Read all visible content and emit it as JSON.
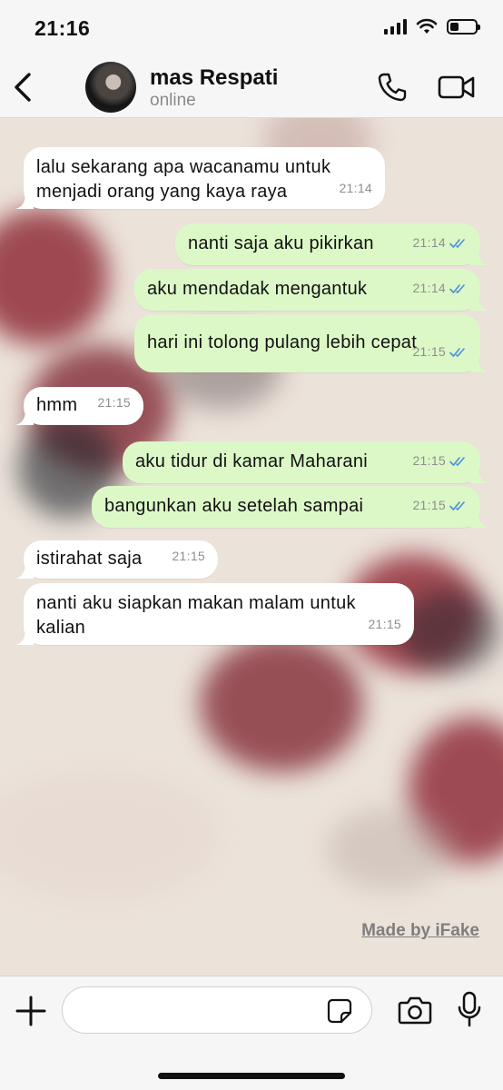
{
  "status_bar": {
    "time": "21:16",
    "battery_level": 0.35
  },
  "header": {
    "contact_name": "mas Respati",
    "contact_status": "online",
    "icons": {
      "back": "chevron-left-icon",
      "call": "phone-icon",
      "video": "video-camera-icon"
    }
  },
  "colors": {
    "incoming_bubble": "#ffffff",
    "outgoing_bubble": "#dcf8c7",
    "tick_read": "#4a90d9"
  },
  "messages": [
    {
      "direction": "in",
      "lines": [
        "lalu sekarang apa wacanamu untuk",
        "menjadi orang yang kaya raya"
      ],
      "time": "21:14"
    },
    {
      "direction": "out",
      "lines": [
        "nanti saja aku pikirkan"
      ],
      "time": "21:14",
      "status": "read"
    },
    {
      "direction": "out",
      "lines": [
        "aku mendadak mengantuk"
      ],
      "time": "21:14",
      "status": "read"
    },
    {
      "direction": "out",
      "lines": [
        "hari ini tolong pulang lebih cepat"
      ],
      "time": "21:15",
      "status": "read"
    },
    {
      "direction": "in",
      "lines": [
        "hmm"
      ],
      "time": "21:15"
    },
    {
      "direction": "out",
      "lines": [
        "aku tidur di kamar Maharani"
      ],
      "time": "21:15",
      "status": "read"
    },
    {
      "direction": "out",
      "lines": [
        "bangunkan aku setelah sampai"
      ],
      "time": "21:15",
      "status": "read"
    },
    {
      "direction": "in",
      "lines": [
        "istirahat saja"
      ],
      "time": "21:15"
    },
    {
      "direction": "in",
      "lines": [
        "nanti aku siapkan makan malam untuk",
        "kalian"
      ],
      "time": "21:15"
    }
  ],
  "watermark": "Made by iFake",
  "input_bar": {
    "placeholder": "",
    "icons": {
      "add": "plus-icon",
      "sticker": "sticker-icon",
      "camera": "camera-icon",
      "mic": "microphone-icon"
    }
  }
}
